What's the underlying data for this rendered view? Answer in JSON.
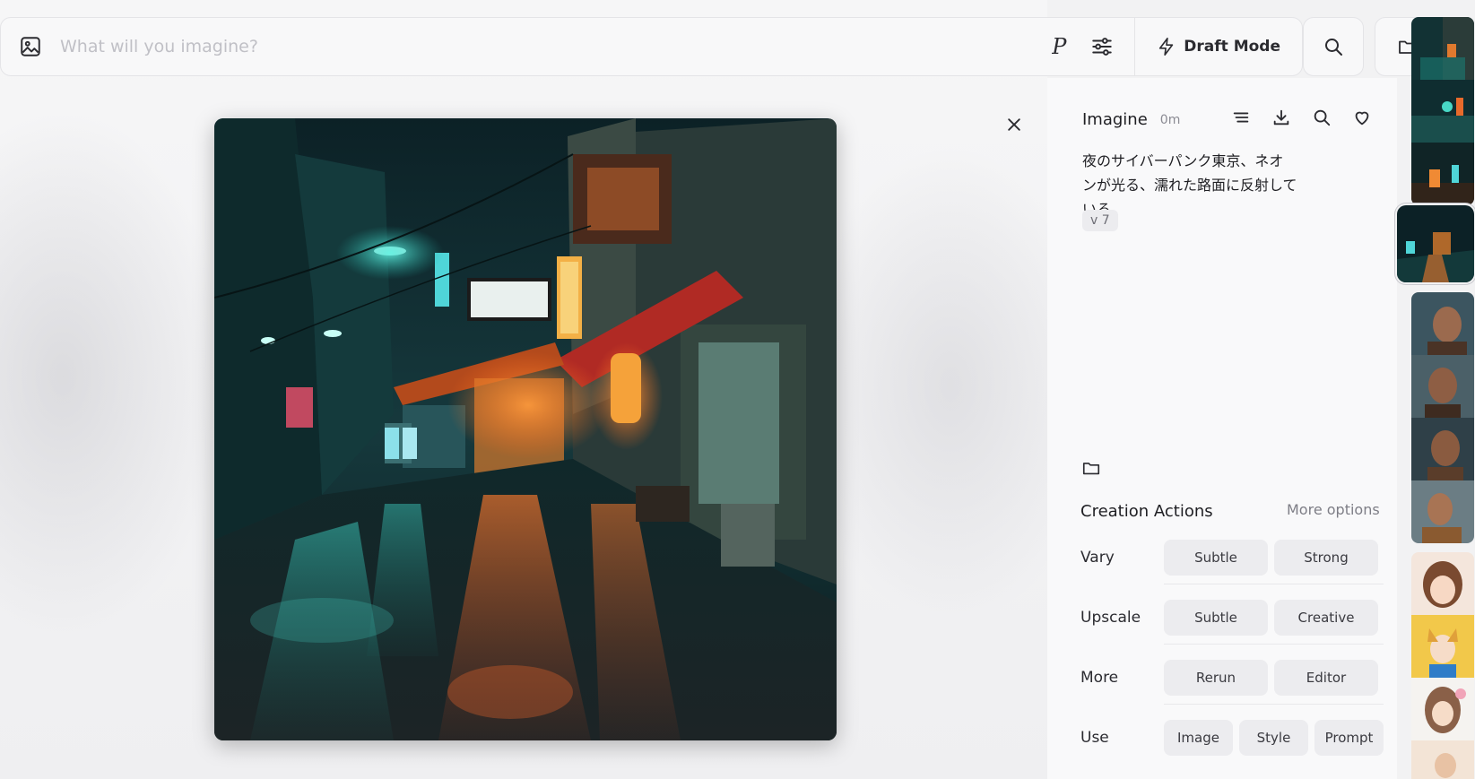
{
  "search": {
    "placeholder": "What will you imagine?",
    "personalize_glyph": "P",
    "draft_mode_label": "Draft Mode"
  },
  "detail": {
    "title": "Imagine",
    "time": "0m",
    "prompt": "夜のサイバーパンク東京、ネオンが光る、濡れた路面に反射している",
    "version": "v 7"
  },
  "actions": {
    "title": "Creation Actions",
    "more_options": "More options",
    "rows": [
      {
        "label": "Vary",
        "buttons": [
          "Subtle",
          "Strong"
        ]
      },
      {
        "label": "Upscale",
        "buttons": [
          "Subtle",
          "Creative"
        ]
      },
      {
        "label": "More",
        "buttons": [
          "Rerun",
          "Editor"
        ]
      },
      {
        "label": "Use",
        "buttons": [
          "Image",
          "Style",
          "Prompt"
        ]
      }
    ]
  },
  "icons": {
    "image": "image-icon",
    "settings": "sliders-icon",
    "draft": "lightning-icon",
    "search": "search-icon",
    "folder": "folder-icon",
    "close": "close-icon",
    "list": "list-icon",
    "download": "download-icon",
    "favorite": "heart-icon"
  },
  "colors": {
    "background": "#f2f2f3",
    "panel": "#f9f9fa",
    "pill": "#ececef",
    "neon_teal": "#1fa39a",
    "neon_orange": "#f07a2a"
  }
}
